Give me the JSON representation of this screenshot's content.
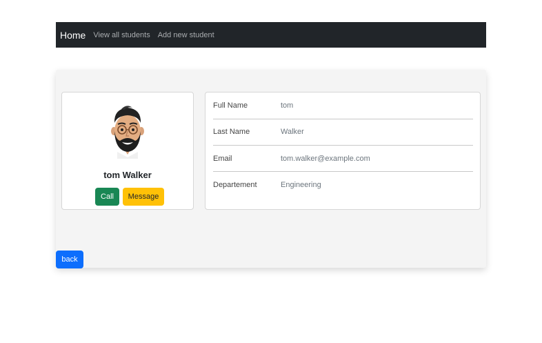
{
  "navbar": {
    "brand": "Home",
    "links": [
      "View all students",
      "Add new student"
    ]
  },
  "profile": {
    "avatar_icon": "avatar-icon",
    "name": "tom Walker",
    "call_label": "Call",
    "message_label": "Message"
  },
  "details": [
    {
      "label": "Full Name",
      "value": "tom"
    },
    {
      "label": "Last Name",
      "value": "Walker"
    },
    {
      "label": "Email",
      "value": "tom.walker@example.com"
    },
    {
      "label": "Departement",
      "value": "Engineering"
    }
  ],
  "back_label": "back",
  "colors": {
    "navbar_bg": "#212529",
    "call_bg": "#198754",
    "message_bg": "#ffc107",
    "back_bg": "#0d6efd"
  }
}
